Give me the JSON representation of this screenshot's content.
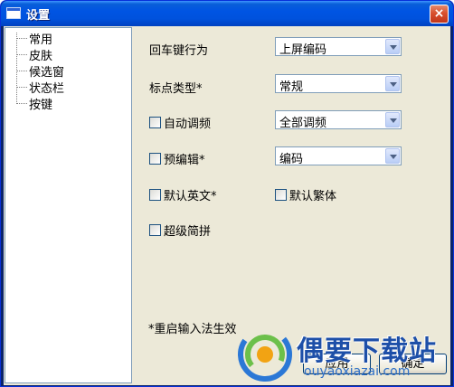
{
  "window": {
    "title": "设置",
    "close_glyph": "×"
  },
  "tree": {
    "items": [
      "常用",
      "皮肤",
      "候选窗",
      "状态栏",
      "按键"
    ]
  },
  "settings": {
    "enter_key": {
      "label": "回车键行为",
      "value": "上屏编码"
    },
    "punct_type": {
      "label": "标点类型*",
      "value": "常规"
    },
    "auto_freq": {
      "label": "自动调频",
      "checked": false,
      "value": "全部调频"
    },
    "pre_edit": {
      "label": "预编辑*",
      "checked": false,
      "value": "编码"
    },
    "default_english": {
      "label": "默认英文*",
      "checked": false
    },
    "default_traditional": {
      "label": "默认繁体",
      "checked": false
    },
    "super_jianpin": {
      "label": "超级简拼",
      "checked": false
    }
  },
  "note": "*重启输入法生效",
  "buttons": {
    "apply": "应用",
    "ok": "确定"
  },
  "watermark": {
    "title": "偶要下载站",
    "url": "ouyaoxiazai.com"
  },
  "colors": {
    "titlebar": "#0054e3",
    "dialog_bg": "#ece9d8",
    "watermark": "#1d4fa8"
  }
}
